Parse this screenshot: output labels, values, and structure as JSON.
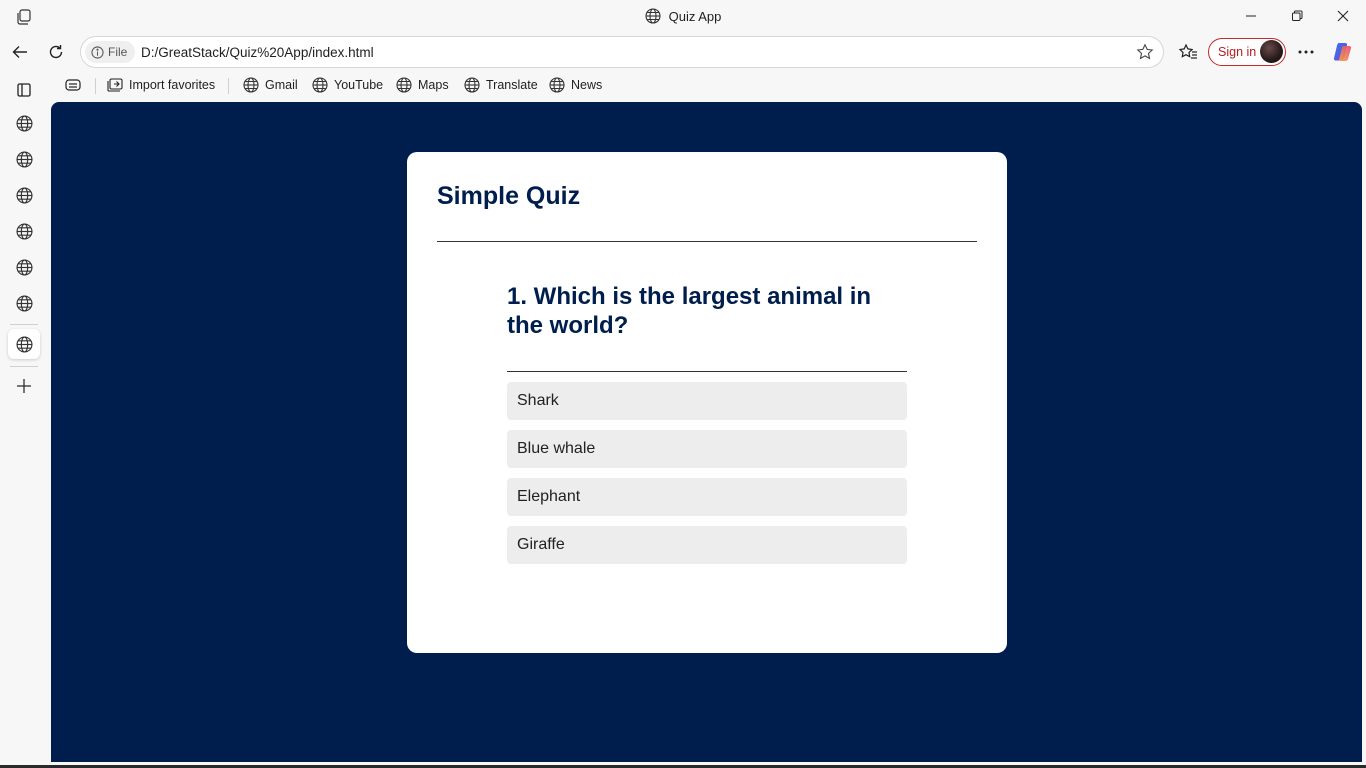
{
  "window": {
    "title": "Quiz App"
  },
  "toolbar": {
    "file_chip": "File",
    "url": "D:/GreatStack/Quiz%20App/index.html",
    "sign_in_label": "Sign in"
  },
  "favorites": {
    "import_label": "Import favorites",
    "items": [
      {
        "label": "Gmail"
      },
      {
        "label": "YouTube"
      },
      {
        "label": "Maps"
      },
      {
        "label": "Translate"
      },
      {
        "label": "News"
      }
    ]
  },
  "page": {
    "heading": "Simple Quiz",
    "question": "1. Which is the largest animal in the world?",
    "answers": [
      {
        "text": "Shark"
      },
      {
        "text": "Blue whale"
      },
      {
        "text": "Elephant"
      },
      {
        "text": "Giraffe"
      }
    ]
  },
  "colors": {
    "page_background": "#001e4d",
    "card_background": "#ffffff",
    "heading_color": "#001e4d",
    "answer_background": "#ededed",
    "signin_accent": "#c22a2a"
  },
  "icons": {
    "title_bar": [
      "workspaces-icon",
      "globe-icon",
      "minimize-icon",
      "restore-icon",
      "close-icon"
    ],
    "nav": [
      "back-icon",
      "refresh-icon",
      "info-icon",
      "star-icon",
      "favorites-icon",
      "more-icon",
      "copilot-icon"
    ],
    "sidebar": [
      "tab-actions-icon",
      "globe-icon",
      "add-icon"
    ]
  }
}
